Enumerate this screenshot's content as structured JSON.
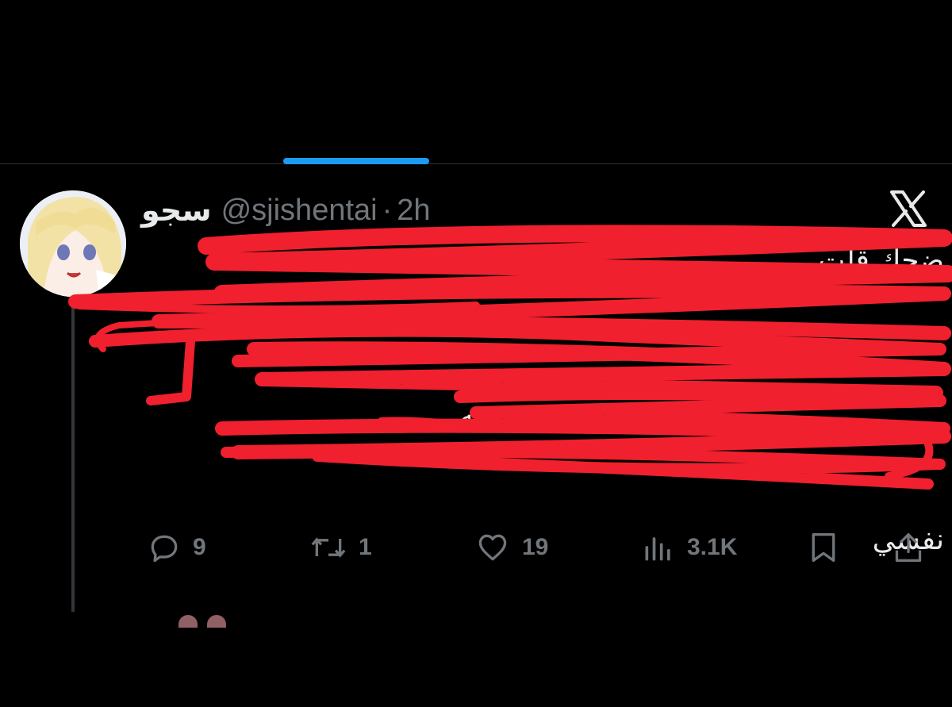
{
  "tweet": {
    "display_name": "سجو",
    "handle": "@sjishentai",
    "separator": "·",
    "time": "2h",
    "text_lines": [
      "ضحك قلت",
      "هههههههههه",
      "نفسي"
    ]
  },
  "actions": {
    "reply_count": "9",
    "retweet_count": "1",
    "like_count": "19",
    "views_count": "3.1K"
  },
  "colors": {
    "background": "#000000",
    "accent": "#1d9bf0",
    "text": "#e7e9ea",
    "muted": "#71767b",
    "scribble": "#f0202e"
  },
  "icons": {
    "reply": "reply-icon",
    "retweet": "retweet-icon",
    "like": "heart-icon",
    "views": "views-chart-icon",
    "bookmark": "bookmark-icon",
    "share": "share-icon",
    "brand": "x-logo-icon"
  }
}
